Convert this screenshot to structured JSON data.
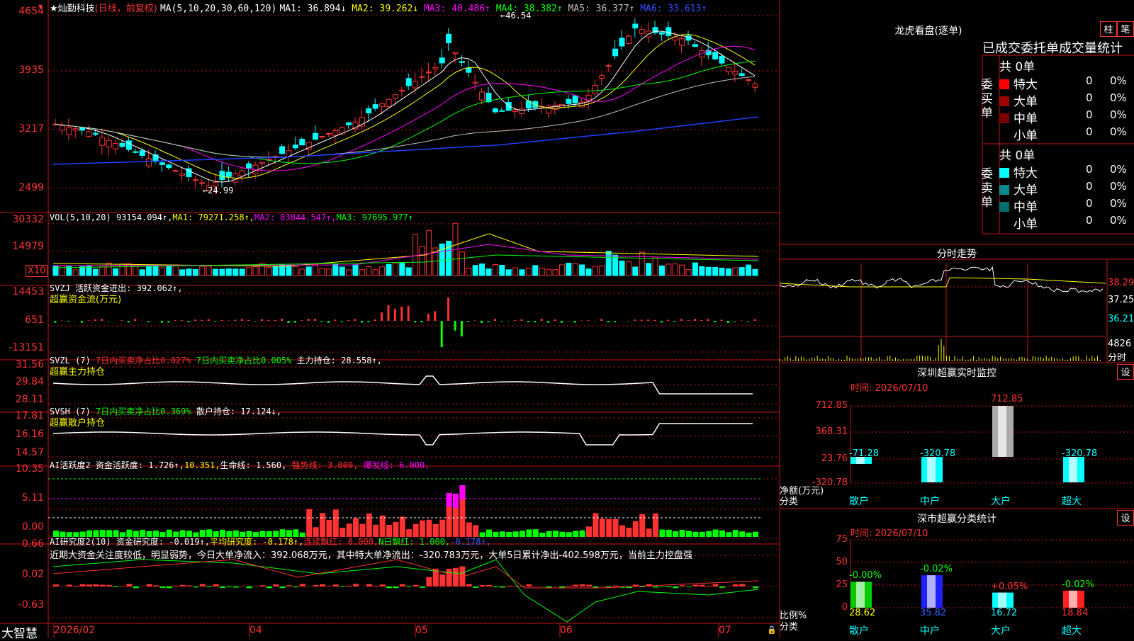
{
  "main": {
    "title_mark": "★",
    "name": "灿勤科技",
    "period": "(日线，前复权)",
    "ma_label": "MA(5,10,20,30,60,120)",
    "ma": [
      {
        "label": "MA1:",
        "val": "36.894",
        "arrow": "↓",
        "color": "#ffffff"
      },
      {
        "label": "MA2:",
        "val": "39.262",
        "arrow": "↓",
        "color": "#ffff00"
      },
      {
        "label": "MA3:",
        "val": "40.486",
        "arrow": "↑",
        "color": "#ff00ff"
      },
      {
        "label": "MA4:",
        "val": "38.382",
        "arrow": "↑",
        "color": "#00ff00"
      },
      {
        "label": "MA5:",
        "val": "36.377",
        "arrow": "↑",
        "color": "#c0c0c0"
      },
      {
        "label": "MA6:",
        "val": "33.613",
        "arrow": "↑",
        "color": "#3050ff"
      }
    ],
    "y_labels": [
      "4654",
      "3935",
      "3217",
      "2499"
    ],
    "high_mark": "46.54",
    "low_mark": "24.99",
    "colors": {
      "up": "#ff3232",
      "down": "#00ffff",
      "grid": "#c81414"
    }
  },
  "vol": {
    "label": "VOL(5,10,20)",
    "val": "93154.094↑,",
    "ma1": "MA1: 79271.258↑,",
    "ma2": "MA2: 83844.547↑,",
    "ma3": "MA3: 97695.977↑",
    "y_labels": [
      "30332",
      "14979"
    ],
    "unit": "X10"
  },
  "svzj": {
    "label": "SVZJ",
    "text": "活跃资金进出: 392.062↑,",
    "sub": "超赢资金流(万元)",
    "y_labels": [
      "14453",
      "651",
      "-13151"
    ]
  },
  "svzl": {
    "label": "SVZL (7)",
    "t1": "7日内买卖净占比0.027%",
    "t2": "7日内买卖净占比0.005%",
    "t3": "主力持仓: 28.558↑,",
    "sub": "超赢主力持仓",
    "y_labels": [
      "31.56",
      "29.84",
      "28.11"
    ]
  },
  "svsh": {
    "label": "SVSH (7)",
    "t1": "7日内买卖净占比0.369%",
    "t2": "散户持仓: 17.124↓,",
    "sub": "超赢散户持仓",
    "y_labels": [
      "17.81",
      "16.16",
      "14.57"
    ]
  },
  "ai1": {
    "label": "AI活跃度2",
    "t1": "资金活跃度: 1.726↑,",
    "t2": "10.351,",
    "t3": "生命线: 1.560,",
    "t4": "强势线: 3.000,",
    "t5": "爆发线: 6.000,",
    "y_labels": [
      "10.35",
      "5.11",
      "0.00"
    ]
  },
  "ai2": {
    "label": "AI研究度2(10)",
    "t1": "资金研究度: -0.019↑,",
    "t2": "平均研究度: -0.178↑,",
    "t3": "连续飘红: 0.000,",
    "t4": "N日飘红: 1.000,",
    "t5": "-0.178↑,",
    "desc": "近期大资金关注度较低，明显弱势，今日大单净流入：392.068万元，其中特大单净流出：-320.783万元，大单5日累计净出-402.598万元，当前主力控盘强",
    "y_labels": [
      "0.66",
      "0.02",
      "-0.63"
    ]
  },
  "xaxis": {
    "brand": "大智慧",
    "labels": [
      "2026/02",
      "04",
      "05",
      "06",
      "07"
    ]
  },
  "right": {
    "lhb_title": "龙虎看盘(逐单)",
    "btn1": "柱",
    "btn2": "笔",
    "stat_title": "已成交委托单成交量统计",
    "buy": {
      "side": "委买单",
      "total": "共 0单",
      "rows": [
        {
          "name": "特大",
          "v": "0",
          "p": "0%",
          "color": "#ff0000"
        },
        {
          "name": "大单",
          "v": "0",
          "p": "0%",
          "color": "#a00000"
        },
        {
          "name": "中单",
          "v": "0",
          "p": "0%",
          "color": "#780000"
        },
        {
          "name": "小单",
          "v": "0",
          "p": "0%",
          "color": ""
        }
      ]
    },
    "sell": {
      "side": "委卖单",
      "total": "共 0单",
      "rows": [
        {
          "name": "特大",
          "v": "0",
          "p": "0%",
          "color": "#00ffff"
        },
        {
          "name": "大单",
          "v": "0",
          "p": "0%",
          "color": "#008c8c"
        },
        {
          "name": "中单",
          "v": "0",
          "p": "0%",
          "color": "#006e6e"
        },
        {
          "name": "小单",
          "v": "0",
          "p": "0%",
          "color": ""
        }
      ]
    },
    "fs_title": "分时走势",
    "fs_y": [
      "38.29",
      "37.25",
      "36.21",
      "4826"
    ],
    "fs_unit": "分时",
    "sz_title": "深圳超赢实时监控",
    "sz_btn": "设",
    "sz_time": "时间: 2026/07/10",
    "sz_y": [
      "712.85",
      "368.31",
      "23.76",
      "-320.78"
    ],
    "sz_ylabel1": "净额(万元)",
    "sz_ylabel2": "分类",
    "sz_cats": [
      "散户",
      "中户",
      "大户",
      "超大"
    ],
    "sz_vals": [
      "-71.28",
      "-320.78",
      "712.85",
      "-320.78"
    ],
    "sz_nums": [
      -71.28,
      -320.78,
      712.85,
      -320.78
    ],
    "fl_title": "深市超赢分类统计",
    "fl_btn": "设",
    "fl_time": "时间: 2026/07/10",
    "fl_y": [
      "75",
      "50",
      "25",
      "0"
    ],
    "fl_ylabel1": "比例%",
    "fl_ylabel2": "分类",
    "fl_cats": [
      "散户",
      "中户",
      "大户",
      "超大"
    ],
    "fl_vals": [
      "28.62",
      "35.82",
      "16.72",
      "18.84"
    ],
    "fl_nums": [
      28.62,
      35.82,
      16.72,
      18.84
    ],
    "fl_tops": [
      "-0.00%",
      "-0.02%",
      "+0.05%",
      "-0.02%"
    ]
  }
}
